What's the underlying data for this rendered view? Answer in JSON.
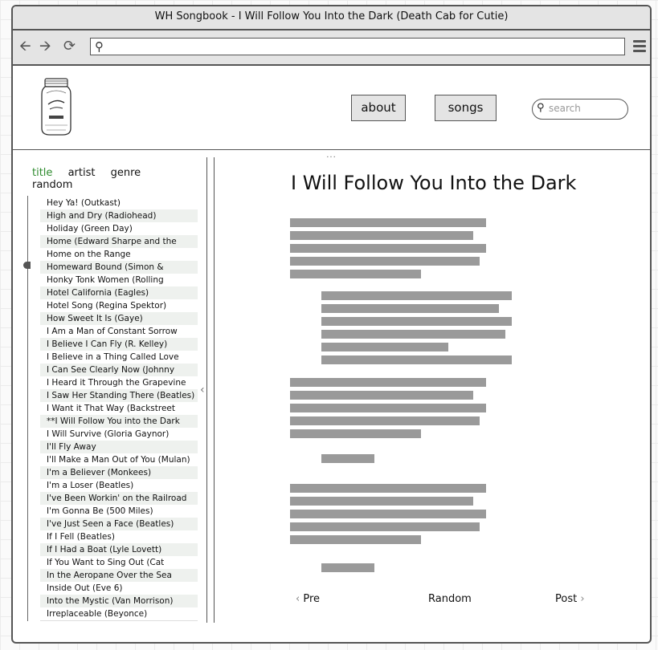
{
  "window": {
    "title": "WH Songbook - I Will Follow You Into the Dark (Death Cab for Cutie)"
  },
  "toolbar": {
    "icons": [
      "back-arrow-icon",
      "forward-arrow-icon",
      "reload-icon",
      "search-icon",
      "menu-icon"
    ]
  },
  "header": {
    "about_label": "about",
    "songs_label": "songs",
    "search_placeholder": "search"
  },
  "sidebar": {
    "tabs": [
      {
        "label": "title",
        "active": true
      },
      {
        "label": "artist",
        "active": false
      },
      {
        "label": "genre",
        "active": false
      },
      {
        "label": "random",
        "active": false
      }
    ],
    "songs": [
      "Hey Ya! (Outkast)",
      "High and Dry (Radiohead)",
      "Holiday (Green Day)",
      "Home (Edward Sharpe and the",
      "Home on the Range",
      "Homeward Bound (Simon &",
      "Honky Tonk Women (Rolling",
      "Hotel California (Eagles)",
      "Hotel Song (Regina Spektor)",
      "How Sweet It Is (Gaye)",
      "I Am a Man of Constant Sorrow",
      "I Believe I Can Fly (R. Kelley)",
      "I Believe in a Thing Called Love",
      "I Can See Clearly Now (Johnny",
      "I Heard it Through the Grapevine",
      "I Saw Her Standing There (Beatles)",
      "I Want it That Way (Backstreet",
      "**I Will Follow You into the Dark",
      "I Will Survive (Gloria Gaynor)",
      "I'll Fly Away",
      "I'll Make a Man Out of You (Mulan)",
      "I'm a Believer (Monkees)",
      "I'm a Loser (Beatles)",
      "I've Been Workin' on the Railroad",
      "I'm Gonna Be (500 Miles)",
      "I've Just Seen a Face (Beatles)",
      "If I Fell (Beatles)",
      "If I Had a Boat (Lyle Lovett)",
      "If You Want to Sing Out (Cat",
      "In the Aeropane Over the Sea",
      "Inside Out (Eve 6)",
      "Into the Mystic (Van Morrison)",
      "Irreplaceable (Beyonce)"
    ]
  },
  "main": {
    "title": "I Will Follow You Into the Dark",
    "pager": {
      "prev": "Pre",
      "random": "Random",
      "next": "Post"
    }
  },
  "colors": {
    "active_tab": "#2e8b2e",
    "accent_gray": "#9a9a9a"
  }
}
